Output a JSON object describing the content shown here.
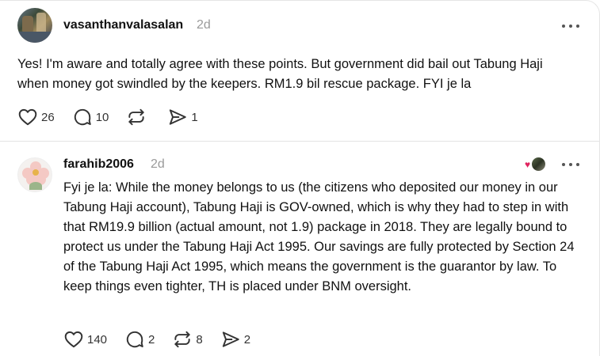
{
  "posts": [
    {
      "username": "vasanthanvalasalan",
      "time": "2d",
      "text": "Yes! I'm aware and totally agree with these points. But government did bail out Tabung Haji when money got swindled by the keepers. RM1.9 bil rescue package. FYI je la",
      "likes": "26",
      "replies": "10",
      "reposts": "",
      "shares": "1"
    },
    {
      "username": "farahib2006",
      "time": "2d",
      "text": "Fyi je la: While the money belongs to us (the citizens who deposited our money in our Tabung Haji account), Tabung Haji is GOV-owned, which is why they had to step in with that RM19.9 billion (actual amount, not 1.9) package in 2018. They are legally bound to protect us under the Tabung Haji Act 1995. Our savings are fully protected by Section 24 of the Tabung Haji Act 1995, which means the government is the guarantor by law. To keep things even tighter, TH is placed under BNM oversight.",
      "likes": "140",
      "replies": "2",
      "reposts": "8",
      "shares": "2"
    }
  ],
  "icons": {
    "like": "heart-icon",
    "reply": "comment-icon",
    "repost": "repost-icon",
    "share": "send-icon",
    "more": "more-icon"
  },
  "colors": {
    "liked_heart": "#e0245e",
    "muted": "#9a9a9a"
  }
}
